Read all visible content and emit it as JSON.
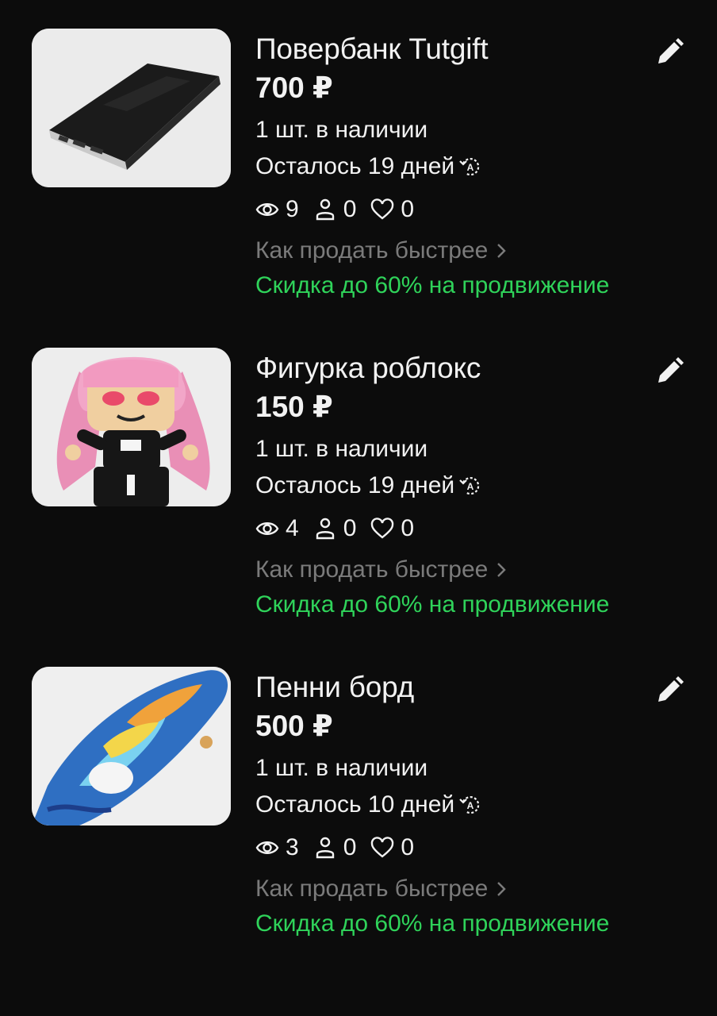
{
  "listings": [
    {
      "title": "Повербанк Tutgift",
      "price": "700 ₽",
      "stock": "1 шт. в наличии",
      "remaining": "Осталось 19 дней",
      "views": "9",
      "contacts": "0",
      "favorites": "0",
      "how_to_sell": "Как продать быстрее",
      "promo": "Скидка до 60% на продвижение",
      "image": "power-bank"
    },
    {
      "title": "Фигурка роблокс",
      "price": "150 ₽",
      "stock": "1 шт. в наличии",
      "remaining": "Осталось 19 дней",
      "views": "4",
      "contacts": "0",
      "favorites": "0",
      "how_to_sell": "Как продать быстрее",
      "promo": "Скидка до 60% на продвижение",
      "image": "roblox-figure"
    },
    {
      "title": "Пенни борд",
      "price": "500 ₽",
      "stock": "1 шт. в наличии",
      "remaining": "Осталось 10 дней",
      "views": "3",
      "contacts": "0",
      "favorites": "0",
      "how_to_sell": "Как продать быстрее",
      "promo": "Скидка до 60% на продвижение",
      "image": "penny-board"
    }
  ],
  "colors": {
    "background": "#0c0c0c",
    "text": "#f2f2f2",
    "muted": "#7b7b7b",
    "promo": "#2fd35a"
  }
}
